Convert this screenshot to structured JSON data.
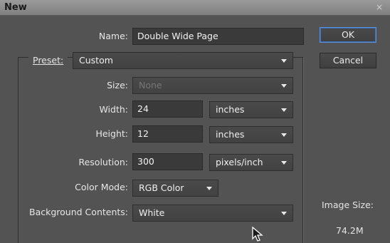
{
  "window": {
    "title": "New",
    "close_glyph": "×"
  },
  "form": {
    "name_label": "Name:",
    "name_value": "Double Wide Page",
    "preset_label": "Preset:",
    "preset_value": "Custom",
    "size_label": "Size:",
    "size_value": "None",
    "width_label": "Width:",
    "width_value": "24",
    "width_unit": "inches",
    "height_label": "Height:",
    "height_value": "12",
    "height_unit": "inches",
    "resolution_label": "Resolution:",
    "resolution_value": "300",
    "resolution_unit": "pixels/inch",
    "color_mode_label": "Color Mode:",
    "color_mode_value": "RGB Color",
    "background_label": "Background Contents:",
    "background_value": "White"
  },
  "buttons": {
    "ok": "OK",
    "cancel": "Cancel"
  },
  "image_size": {
    "label": "Image Size:",
    "value": "74.2M"
  },
  "colors": {
    "background": "#535353",
    "field": "#3a3a3a",
    "ok_focus": "#5b8fd6"
  }
}
